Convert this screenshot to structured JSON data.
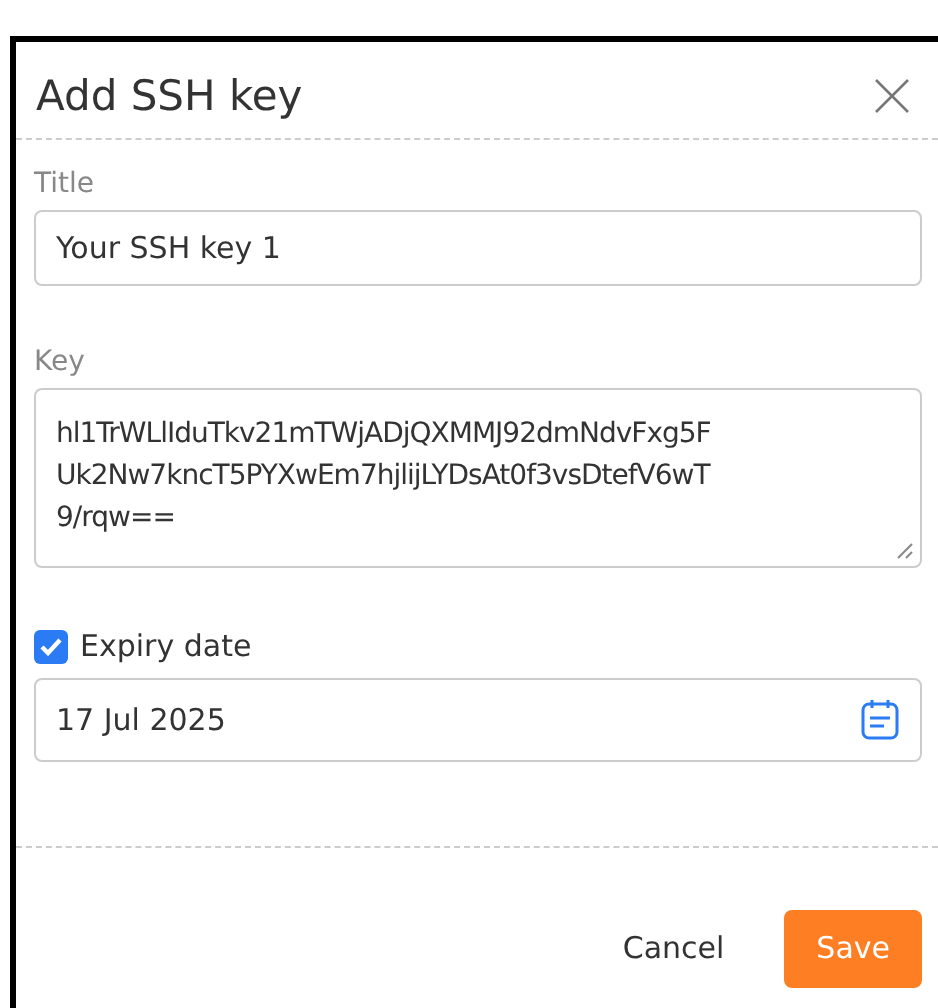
{
  "dialog": {
    "title": "Add SSH key"
  },
  "fields": [
    {
      "kind": "text",
      "label": "Title",
      "value": "Your SSH key 1"
    },
    {
      "kind": "textarea",
      "label": "Key",
      "lines": [
        "hl1TrWLlIduTkv21mTWjADjQXMMJ92dmNdvFxg5F",
        "Uk2Nw7kncT5PYXwEm7hjlijLYDsAt0f3vsDtefV6wT",
        "9/rqw=="
      ]
    }
  ],
  "expiry": {
    "label": "Expiry date",
    "checked": true,
    "value": "17 Jul 2025"
  },
  "buttons": [
    {
      "kind": "secondary",
      "label": "Cancel"
    },
    {
      "kind": "primary",
      "label": "Save"
    }
  ]
}
